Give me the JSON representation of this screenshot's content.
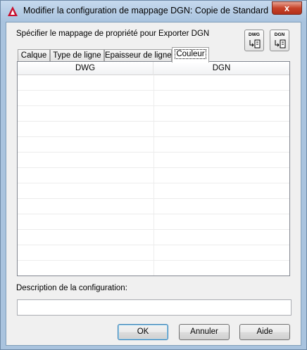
{
  "window": {
    "title": "Modifier la configuration de mappage DGN: Copie de Standard",
    "close_glyph": "x"
  },
  "header": {
    "prompt": "Spécifier le mappage de propriété pour Exporter DGN",
    "import_button_label": "DWG",
    "export_button_label": "DGN"
  },
  "tabs": [
    {
      "label": "Calque",
      "active": false
    },
    {
      "label": "Type de ligne",
      "active": false
    },
    {
      "label": "Epaisseur de ligne",
      "active": false
    },
    {
      "label": "Couleur",
      "active": true
    }
  ],
  "table": {
    "columns": [
      "DWG",
      "DGN"
    ],
    "rows": []
  },
  "description": {
    "label": "Description de la configuration:",
    "value": ""
  },
  "buttons": {
    "ok": "OK",
    "cancel": "Annuler",
    "help": "Aide"
  },
  "colors": {
    "accent": "#3c7fb1",
    "app_icon": "#c8102e"
  },
  "icons": {
    "app": "autocad-logo-icon",
    "import": "dwg-import-icon",
    "export": "dgn-export-icon"
  }
}
